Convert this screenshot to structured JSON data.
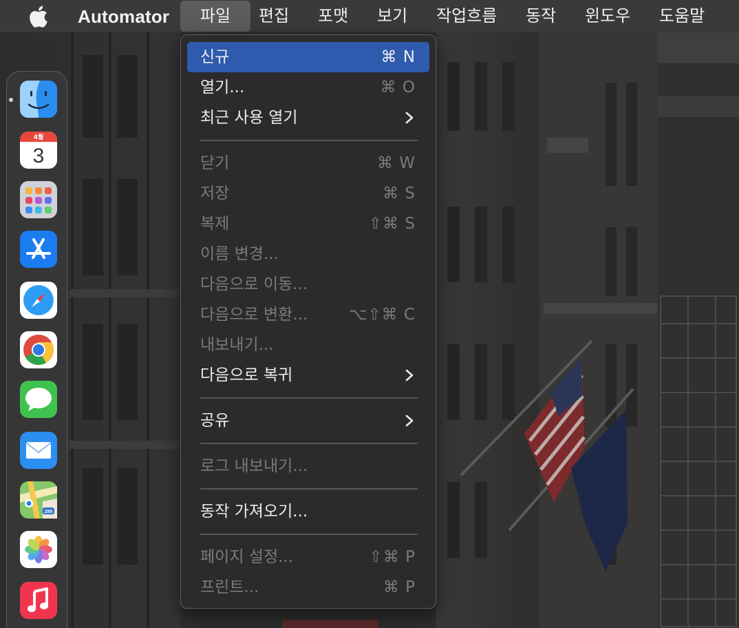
{
  "menubar": {
    "app_name": "Automator",
    "menus": [
      "파일",
      "편집",
      "포맷",
      "보기",
      "작업흐름",
      "동작",
      "윈도우",
      "도움말"
    ]
  },
  "file_menu": {
    "items": [
      {
        "label": "신규",
        "shortcut": "⌘ N",
        "state": "selected"
      },
      {
        "label": "열기...",
        "shortcut": "⌘ O",
        "state": "enabled"
      },
      {
        "label": "최근 사용 열기",
        "shortcut": "",
        "state": "enabled",
        "submenu": true
      },
      {
        "label": "닫기",
        "shortcut": "⌘ W",
        "state": "disabled"
      },
      {
        "label": "저장",
        "shortcut": "⌘ S",
        "state": "disabled"
      },
      {
        "label": "복제",
        "shortcut": "⇧⌘ S",
        "state": "disabled"
      },
      {
        "label": "이름 변경...",
        "shortcut": "",
        "state": "disabled"
      },
      {
        "label": "다음으로 이동...",
        "shortcut": "",
        "state": "disabled"
      },
      {
        "label": "다음으로 변환...",
        "shortcut": "⌥⇧⌘ C",
        "state": "disabled"
      },
      {
        "label": "내보내기...",
        "shortcut": "",
        "state": "disabled"
      },
      {
        "label": "다음으로 복귀",
        "shortcut": "",
        "state": "enabled",
        "submenu": true
      },
      {
        "label": "공유",
        "shortcut": "",
        "state": "enabled",
        "submenu": true
      },
      {
        "label": "로그 내보내기...",
        "shortcut": "",
        "state": "disabled"
      },
      {
        "label": "동작 가져오기...",
        "shortcut": "",
        "state": "enabled"
      },
      {
        "label": "페이지 설정...",
        "shortcut": "⇧⌘ P",
        "state": "disabled"
      },
      {
        "label": "프린트...",
        "shortcut": "⌘ P",
        "state": "disabled"
      }
    ]
  },
  "dock": {
    "calendar_month": "4월",
    "calendar_day": "3",
    "apps": [
      "finder-icon",
      "calendar-icon",
      "launchpad-icon",
      "app-store-icon",
      "safari-icon",
      "chrome-icon",
      "messages-icon",
      "mail-icon",
      "maps-icon",
      "photos-icon",
      "music-icon"
    ],
    "maps_badge": "280"
  },
  "colors": {
    "menubar_bg": "#3a3a3b",
    "menu_bg": "#2c2c2e",
    "selection": "#2e5bae",
    "disabled_text": "#7a7a7c"
  }
}
